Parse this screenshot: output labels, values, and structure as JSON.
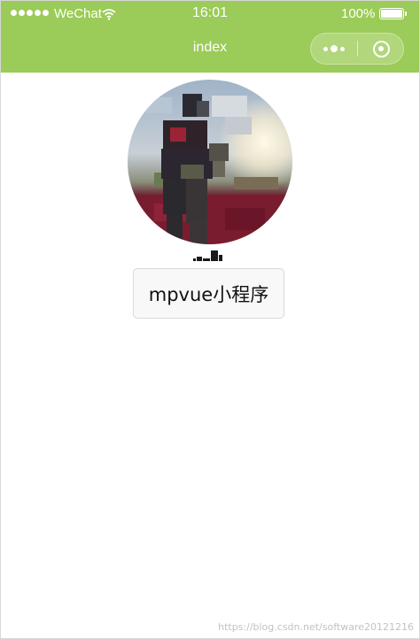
{
  "status_bar": {
    "carrier": "WeChat",
    "time": "16:01",
    "battery": "100%",
    "battery_level": 1.0,
    "signal_icon": "signal-dots-icon",
    "wifi_icon": "wifi-icon",
    "battery_icon": "battery-icon"
  },
  "nav": {
    "title": "index",
    "more_icon": "more-dots-icon",
    "close_icon": "target-close-icon"
  },
  "profile": {
    "avatar_icon": "user-avatar-image"
  },
  "main_button": {
    "label": "mpvue小程序"
  },
  "watermark": {
    "text": "https://blog.csdn.net/software20121216"
  },
  "colors": {
    "header": "#9bcb58",
    "background": "#ffffff",
    "button_bg": "#f8f8f8",
    "button_border": "#d9d9d9"
  }
}
